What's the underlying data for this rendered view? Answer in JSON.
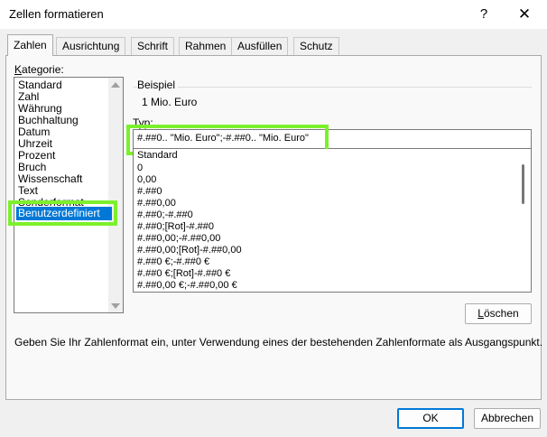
{
  "window": {
    "title": "Zellen formatieren",
    "help_glyph": "?",
    "close_glyph": "✕"
  },
  "tabs": [
    {
      "label": "Zahlen",
      "active": true
    },
    {
      "label": "Ausrichtung",
      "active": false
    },
    {
      "label": "Schrift",
      "active": false
    },
    {
      "label": "Rahmen",
      "active": false
    },
    {
      "label": "Ausfüllen",
      "active": false
    },
    {
      "label": "Schutz",
      "active": false
    }
  ],
  "kategorie": {
    "label_first": "K",
    "label_rest": "ategorie:",
    "items": [
      "Standard",
      "Zahl",
      "Währung",
      "Buchhaltung",
      "Datum",
      "Uhrzeit",
      "Prozent",
      "Bruch",
      "Wissenschaft",
      "Text",
      "Sonderformat"
    ],
    "selected": "Benutzerdefiniert"
  },
  "beispiel": {
    "label": "Beispiel",
    "value": "1 Mio. Euro"
  },
  "typ": {
    "label_first": "T",
    "label_rest": "yp:",
    "value": "#.##0.. \"Mio. Euro\";-#.##0.. \"Mio. Euro\""
  },
  "formats": [
    "Standard",
    "0",
    "0,00",
    "#.##0",
    "#.##0,00",
    "#.##0;-#.##0",
    "#.##0;[Rot]-#.##0",
    "#.##0,00;-#.##0,00",
    "#.##0,00;[Rot]-#.##0,00",
    "#.##0 €;-#.##0 €",
    "#.##0 €;[Rot]-#.##0 €",
    "#.##0,00 €;-#.##0,00 €"
  ],
  "buttons": {
    "loeschen_first": "L",
    "loeschen_rest": "öschen",
    "ok": "OK",
    "abbrechen": "Abbrechen"
  },
  "hint": "Geben Sie Ihr Zahlenformat ein, unter Verwendung eines der bestehenden Zahlenformate als Ausgangspunkt.",
  "colors": {
    "highlight_frame": "#7cf02c",
    "selection": "#0078d7"
  }
}
